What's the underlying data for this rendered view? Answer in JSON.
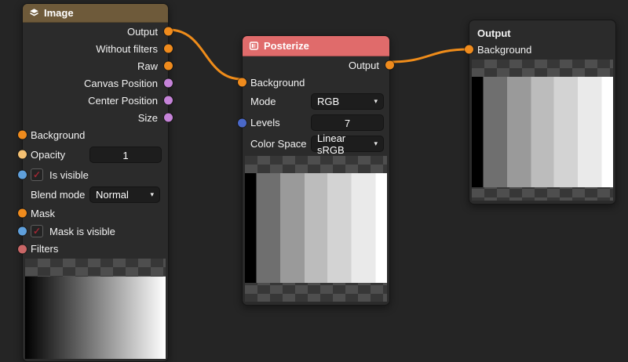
{
  "canvas": {
    "background": "#252525",
    "wire_color": "#ef8c1a"
  },
  "glyphs": {
    "check": "✓",
    "caret": "▾"
  },
  "checkerboard": {
    "light": "#4e4e4e",
    "dark": "#373737"
  },
  "nodes": {
    "image": {
      "title": "Image",
      "icon": "layers-icon",
      "header_color": "#6e5a3a",
      "outputs": [
        {
          "label": "Output",
          "color": "#ef8b1d"
        },
        {
          "label": "Without filters",
          "color": "#ef8b1d"
        },
        {
          "label": "Raw",
          "color": "#ef8b1d"
        },
        {
          "label": "Canvas Position",
          "color": "#c583d8"
        },
        {
          "label": "Center Position",
          "color": "#c583d8"
        },
        {
          "label": "Size",
          "color": "#c583d8"
        }
      ],
      "inputs": {
        "background": {
          "label": "Background",
          "color": "#ef8b1d"
        },
        "opacity": {
          "label": "Opacity",
          "color": "#f5c173",
          "value": "1"
        },
        "is_visible": {
          "label": "Is visible",
          "color": "#5fa0dc",
          "checked": true
        },
        "blend_mode": {
          "label": "Blend mode",
          "value": "Normal"
        },
        "mask": {
          "label": "Mask",
          "color": "#ef8b1d"
        },
        "mask_is_visible": {
          "label": "Mask is visible",
          "color": "#5fa0dc",
          "checked": true
        },
        "filters": {
          "label": "Filters",
          "color": "#c96666"
        }
      },
      "preview": {
        "gradient_from": "#000000",
        "gradient_to": "#ffffff"
      }
    },
    "posterize": {
      "title": "Posterize",
      "icon": "posterize-icon",
      "header_color": "#e06b6b",
      "output": {
        "label": "Output",
        "color": "#ef8b1d"
      },
      "background": {
        "label": "Background",
        "color": "#ef8b1d"
      },
      "mode": {
        "label": "Mode",
        "value": "RGB"
      },
      "levels": {
        "label": "Levels",
        "value": "7",
        "color": "#4a68c8"
      },
      "color_space": {
        "label": "Color Space",
        "value": "Linear sRGB"
      }
    },
    "output": {
      "title": "Output",
      "background": {
        "label": "Background",
        "color": "#ef8b1d"
      }
    }
  },
  "posterized_bands": {
    "colors": [
      "#000000",
      "#6f6f6f",
      "#9a9a9a",
      "#bcbcbc",
      "#d3d3d3",
      "#eaeaea",
      "#ffffff"
    ],
    "stops_pct": [
      0,
      8,
      25,
      42,
      58,
      75,
      92,
      100
    ]
  }
}
